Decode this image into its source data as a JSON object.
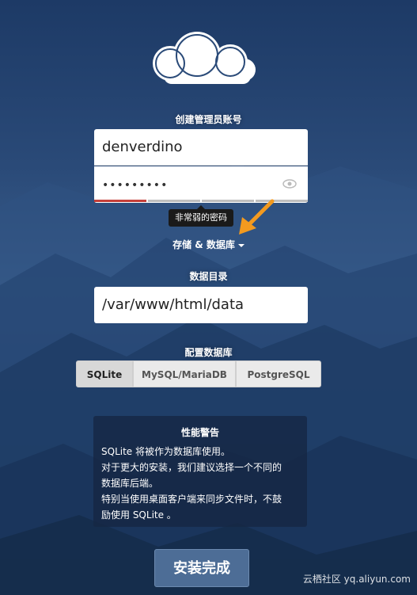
{
  "admin_section": {
    "title": "创建管理员账号"
  },
  "username": {
    "value": "denverdino"
  },
  "password": {
    "masked_value": "•••••••••",
    "strength_text": "非常弱的密码",
    "strength_level": 0.2
  },
  "storage_toggle": {
    "label": "存储 & 数据库"
  },
  "data_dir": {
    "label": "数据目录",
    "value": "/var/www/html/data"
  },
  "db_section": {
    "label": "配置数据库",
    "options": [
      "SQLite",
      "MySQL/MariaDB",
      "PostgreSQL"
    ],
    "selected": "SQLite"
  },
  "warning": {
    "title": "性能警告",
    "lines": [
      "SQLite 将被作为数据库使用。",
      "对于更大的安装，我们建议选择一个不同的",
      "数据库后端。",
      "特别当使用桌面客户端来同步文件时，不鼓",
      "励使用 SQLite 。"
    ]
  },
  "install_button": {
    "label": "安装完成"
  },
  "watermark": {
    "text": "云栖社区 yq.aliyun.com"
  },
  "colors": {
    "accent": "#4d6d96",
    "strength_bar": "#c5403a",
    "arrow": "#f39a1f"
  }
}
